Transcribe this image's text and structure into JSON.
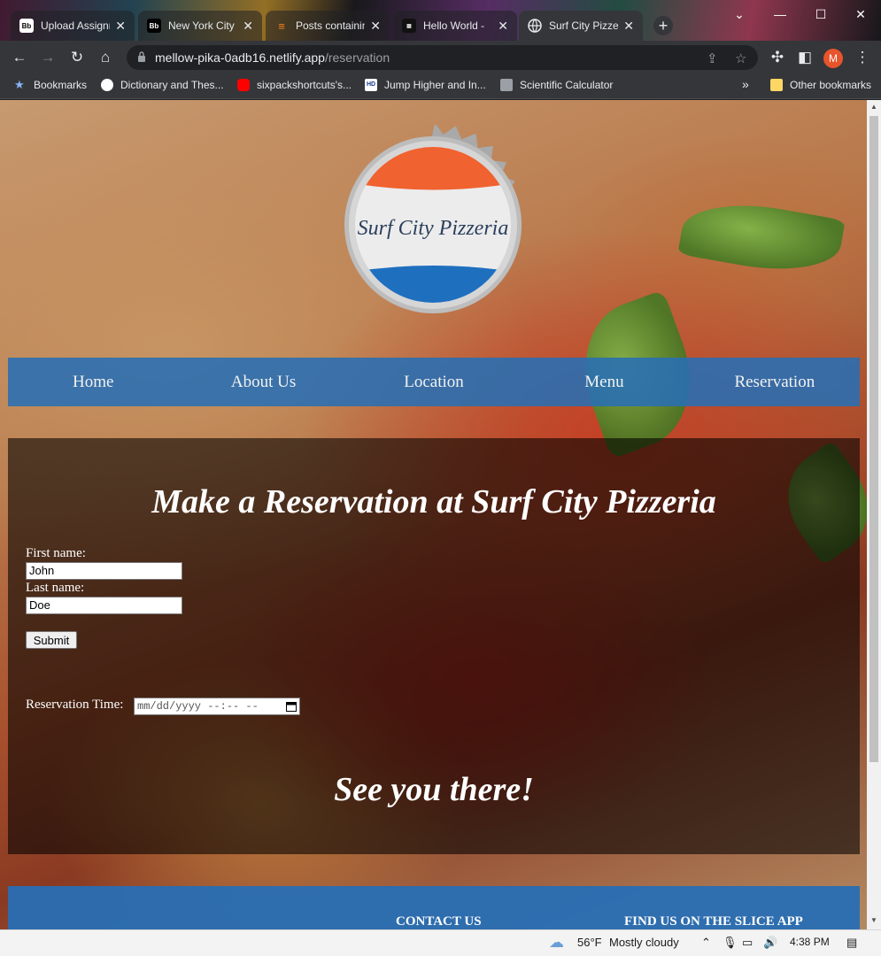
{
  "tabs": [
    {
      "title": "Upload Assignment",
      "favicon": "Bb",
      "active": false
    },
    {
      "title": "New York City",
      "favicon": "Bb",
      "active": false
    },
    {
      "title": "Posts containing",
      "favicon": "stack",
      "active": false
    },
    {
      "title": "Hello World - ",
      "favicon": "hmm",
      "active": false
    },
    {
      "title": "Surf City Pizzeria",
      "favicon": "globe",
      "active": true
    }
  ],
  "address": {
    "host": "mellow-pika-0adb16.netlify.app",
    "path": "/reservation"
  },
  "profile_initial": "M",
  "bookmarks": [
    {
      "label": "Bookmarks"
    },
    {
      "label": "Dictionary and Thes..."
    },
    {
      "label": "sixpackshortcuts's..."
    },
    {
      "label": "Jump Higher and In..."
    },
    {
      "label": "Scientific Calculator"
    }
  ],
  "bookmarks_overflow": "»",
  "other_bookmarks": "Other bookmarks",
  "site": {
    "logo_text": "Surf City Pizzeria",
    "nav": [
      "Home",
      "About Us",
      "Location",
      "Menu",
      "Reservation"
    ],
    "heading": "Make a Reservation at Surf City Pizzeria",
    "form": {
      "first_name_label": "First name:",
      "first_name_value": "John",
      "last_name_label": "Last name:",
      "last_name_value": "Doe",
      "submit_label": "Submit",
      "reservation_label": "Reservation Time:",
      "reservation_placeholder": "mm/dd/yyyy --:-- --"
    },
    "closing": "See you there!",
    "footer": {
      "contact": "CONTACT US",
      "slice": "FIND US ON THE SLICE APP"
    }
  },
  "taskbar": {
    "weather_temp": "56°F",
    "weather_desc": "Mostly cloudy",
    "time": "4:38 PM"
  },
  "colors": {
    "nav_blue": "#286eb4",
    "logo_orange": "#f0622f",
    "logo_blue": "#1f6fbf"
  }
}
